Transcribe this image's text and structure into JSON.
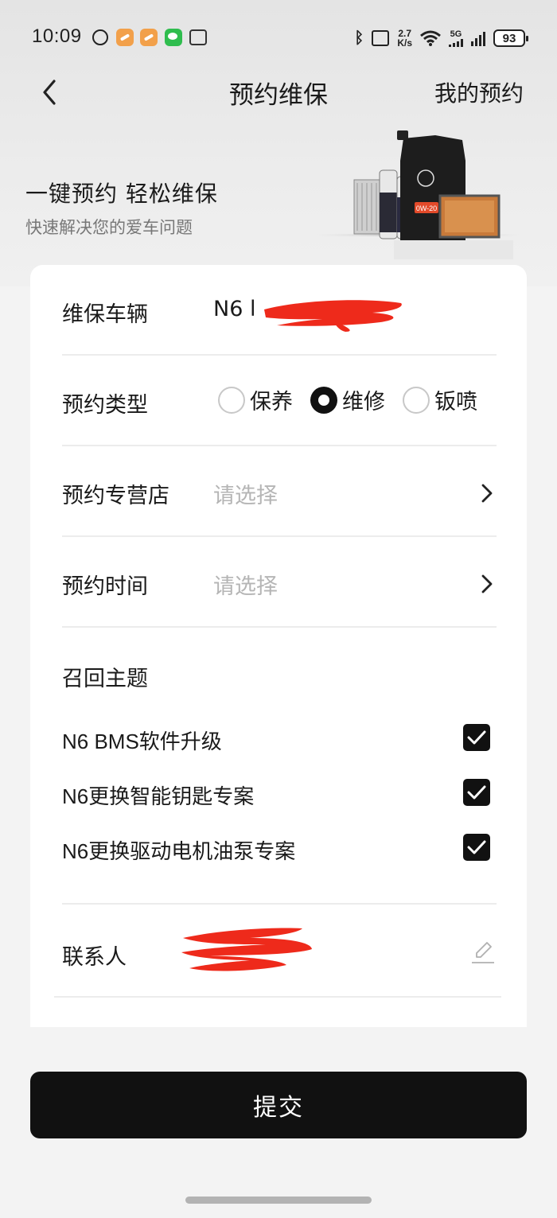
{
  "status_bar": {
    "time": "10:09",
    "net_speed_top": "2.7",
    "net_speed_bottom": "K/s",
    "network": "5G",
    "battery": "93"
  },
  "header": {
    "title": "预约维保",
    "right_link": "我的预约"
  },
  "hero": {
    "title": "一键预约  轻松维保",
    "subtitle": "快速解决您的爱车问题"
  },
  "form": {
    "vehicle": {
      "label": "维保车辆",
      "value": "N6 l"
    },
    "type": {
      "label": "预约类型",
      "options": [
        {
          "label": "保养",
          "checked": false
        },
        {
          "label": "维修",
          "checked": true
        },
        {
          "label": "钣喷",
          "checked": false
        }
      ]
    },
    "store": {
      "label": "预约专营店",
      "placeholder": "请选择"
    },
    "time": {
      "label": "预约时间",
      "placeholder": "请选择"
    },
    "recall": {
      "title": "召回主题",
      "items": [
        {
          "label": "N6 BMS软件升级",
          "checked": true
        },
        {
          "label": "N6更换智能钥匙专案",
          "checked": true
        },
        {
          "label": "N6更换驱动电机油泵专案",
          "checked": true
        }
      ]
    },
    "contact": {
      "label": "联系人"
    }
  },
  "submit_label": "提交",
  "colors": {
    "accent": "#111111",
    "redaction": "#ee2a1b",
    "placeholder": "#b5b5b5"
  }
}
